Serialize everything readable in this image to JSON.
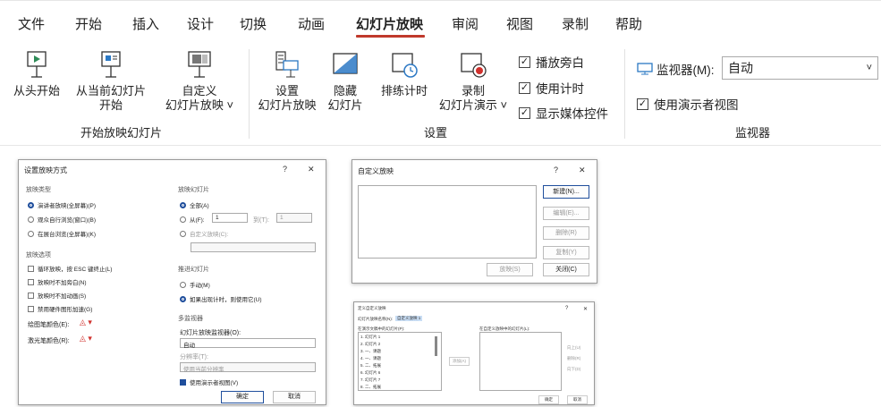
{
  "ribbon": {
    "tabs": [
      "文件",
      "开始",
      "插入",
      "设计",
      "切换",
      "动画",
      "幻灯片放映",
      "审阅",
      "视图",
      "录制",
      "帮助"
    ],
    "active_tab": "幻灯片放映",
    "accent_color": "#c0392b",
    "start_group": {
      "from_beginning": "从头开始",
      "from_current_line1": "从当前幻灯片",
      "from_current_line2": "开始",
      "custom_line1": "自定义",
      "custom_line2": "幻灯片放映 ˅",
      "label": "开始放映幻灯片"
    },
    "setup_group": {
      "setup_line1": "设置",
      "setup_line2": "幻灯片放映",
      "hide_line1": "隐藏",
      "hide_line2": "幻灯片",
      "rehearse": "排练计时",
      "record_line1": "录制",
      "record_line2": "幻灯片演示 ˅",
      "play_narration": "播放旁白",
      "use_timings": "使用计时",
      "show_media_controls": "显示媒体控件",
      "label": "设置"
    },
    "monitors_group": {
      "monitor_label": "监视器(M):",
      "monitor_value": "自动",
      "presenter_view": "使用演示者视图",
      "label": "监视器"
    }
  },
  "setup_dialog": {
    "title": "设置放映方式",
    "help": "?",
    "close": "✕",
    "show_type": {
      "header": "放映类型",
      "options": [
        "演讲者放映(全屏幕)(P)",
        "观众自行浏览(窗口)(B)",
        "在展台浏览(全屏幕)(K)"
      ],
      "selected_index": 0
    },
    "show_options": {
      "header": "放映选项",
      "items": [
        "循环放映，按 ESC 键终止(L)",
        "放映时不加旁白(N)",
        "放映时不加动画(S)",
        "禁用硬件图形加速(G)"
      ],
      "pen_color": "绘图笔颜色(E):",
      "laser_color": "激光笔颜色(R):"
    },
    "show_slides": {
      "header": "放映幻灯片",
      "all": "全部(A)",
      "from": "从(F):",
      "from_value": "1",
      "to": "到(T):",
      "to_value": "1",
      "custom": "自定义放映(C):"
    },
    "advance": {
      "header": "推进幻灯片",
      "manual": "手动(M)",
      "timings": "如果出现计时，则使用它(U)"
    },
    "multi_monitor": {
      "header": "多监视器",
      "monitor_label": "幻灯片放映监视器(O):",
      "monitor_value": "自动",
      "resolution_label": "分辨率(T):",
      "resolution_value": "使用当前分辨率",
      "presenter_view": "使用演示者视图(V)"
    },
    "ok": "确定",
    "cancel": "取消"
  },
  "custom_dialog": {
    "title": "自定义放映",
    "help": "?",
    "close": "✕",
    "new": "新建(N)...",
    "edit": "编辑(E)...",
    "remove": "删除(R)",
    "copy": "复制(Y)",
    "show": "放映(S)",
    "close_btn": "关闭(C)"
  },
  "define_dialog": {
    "title": "定义自定义放映",
    "help": "?",
    "close": "✕",
    "name_label": "幻灯片放映名称(N):",
    "name_value": "自定义放映 1",
    "left_header": "在演示文稿中的幻灯片(P):",
    "right_header": "在自定义放映中的幻灯片(L):",
    "slides": [
      "1. 幻灯片 1",
      "2. 幻灯片 2",
      "3. 一、课题",
      "4. 一、课题",
      "5. 二、拓展",
      "6. 幻灯片 6",
      "7. 幻灯片 7",
      "8. 二、拓展"
    ],
    "add": "添加(A)",
    "up": "向上(U)",
    "delete": "删除(R)",
    "down": "向下(D)",
    "ok": "确定",
    "cancel": "取消"
  }
}
